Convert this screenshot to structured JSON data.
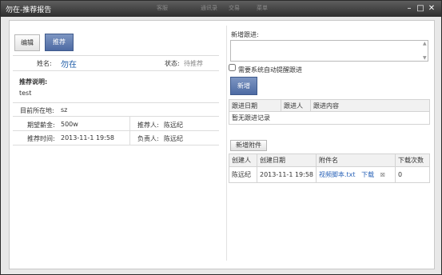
{
  "window": {
    "title": "勿在-推荐报告",
    "ghost_items": [
      "客服",
      "通讯录",
      "交易",
      "菜单"
    ]
  },
  "left": {
    "tabs": [
      {
        "label": "编辑",
        "active": false
      },
      {
        "label": "推荐",
        "active": true
      }
    ],
    "name_label": "姓名:",
    "name_value": "勿在",
    "status_label": "状态:",
    "status_value": "待推荐",
    "note_title": "推荐说明:",
    "note_text": "test",
    "location_label": "目前所在地:",
    "location_value": "sz",
    "salary_label": "期望薪金:",
    "salary_value": "500w",
    "recommender_label": "推荐人:",
    "recommender_value": "陈远纪",
    "time_label": "推荐时间:",
    "time_value": "2013-11-1 19:58",
    "owner_label": "负责人:",
    "owner_value": "陈远纪"
  },
  "right": {
    "followup_label": "新增跟进:",
    "followup_value": "",
    "auto_remind_label": "需要系统自动提醒跟进",
    "auto_remind_checked": false,
    "add_button": "新增",
    "followup_table": {
      "headers": [
        "跟进日期",
        "跟进人",
        "跟进内容"
      ],
      "empty_text": "暂无跟进记录"
    },
    "add_attachment_button": "新增附件",
    "attachments": {
      "headers": [
        "创建人",
        "创建日期",
        "附件名",
        "下载次数"
      ],
      "rows": [
        {
          "creator": "陈远纪",
          "date": "2013-11-1 19:58",
          "file": "视频脚本.txt",
          "download": "下载",
          "count": "0"
        }
      ]
    }
  },
  "colors": {
    "accent": "#4d6aa3",
    "link": "#2a63b8",
    "name": "#1f5da8"
  }
}
